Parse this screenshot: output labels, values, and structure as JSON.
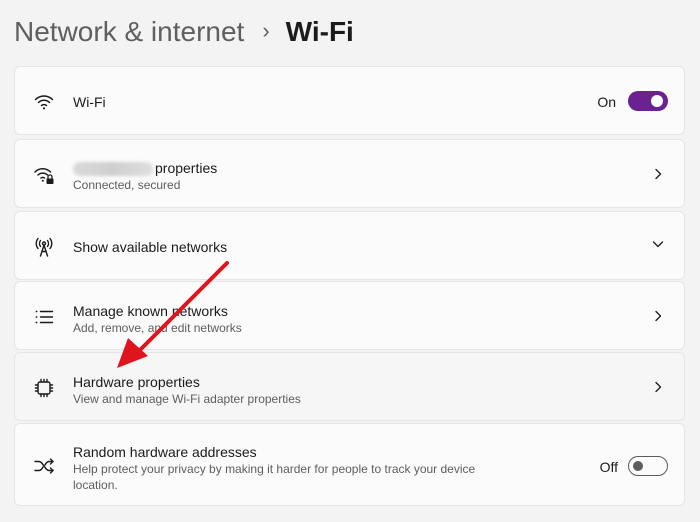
{
  "breadcrumb": {
    "parent": "Network & internet",
    "separator": "›",
    "current": "Wi-Fi"
  },
  "wifi": {
    "icon": "wifi-icon",
    "title": "Wi-Fi",
    "state_label": "On",
    "toggle_on": true
  },
  "network_properties": {
    "icon": "wifi-secured-icon",
    "title": "properties",
    "subtitle": "Connected, secured"
  },
  "available_networks": {
    "icon": "antenna-icon",
    "title": "Show available networks"
  },
  "known_networks": {
    "icon": "list-icon",
    "title": "Manage known networks",
    "subtitle": "Add, remove, and edit networks"
  },
  "hardware_properties": {
    "icon": "chip-icon",
    "title": "Hardware properties",
    "subtitle": "View and manage Wi-Fi adapter properties"
  },
  "random_addresses": {
    "icon": "shuffle-icon",
    "title": "Random hardware addresses",
    "subtitle": "Help protect your privacy by making it harder for people to track your device location.",
    "state_label": "Off",
    "toggle_on": false
  },
  "colors": {
    "accent": "#6b2290",
    "annotation_arrow": "#e0141e",
    "page_background": "#f3f3f3",
    "card_background": "#fbfbfb"
  }
}
